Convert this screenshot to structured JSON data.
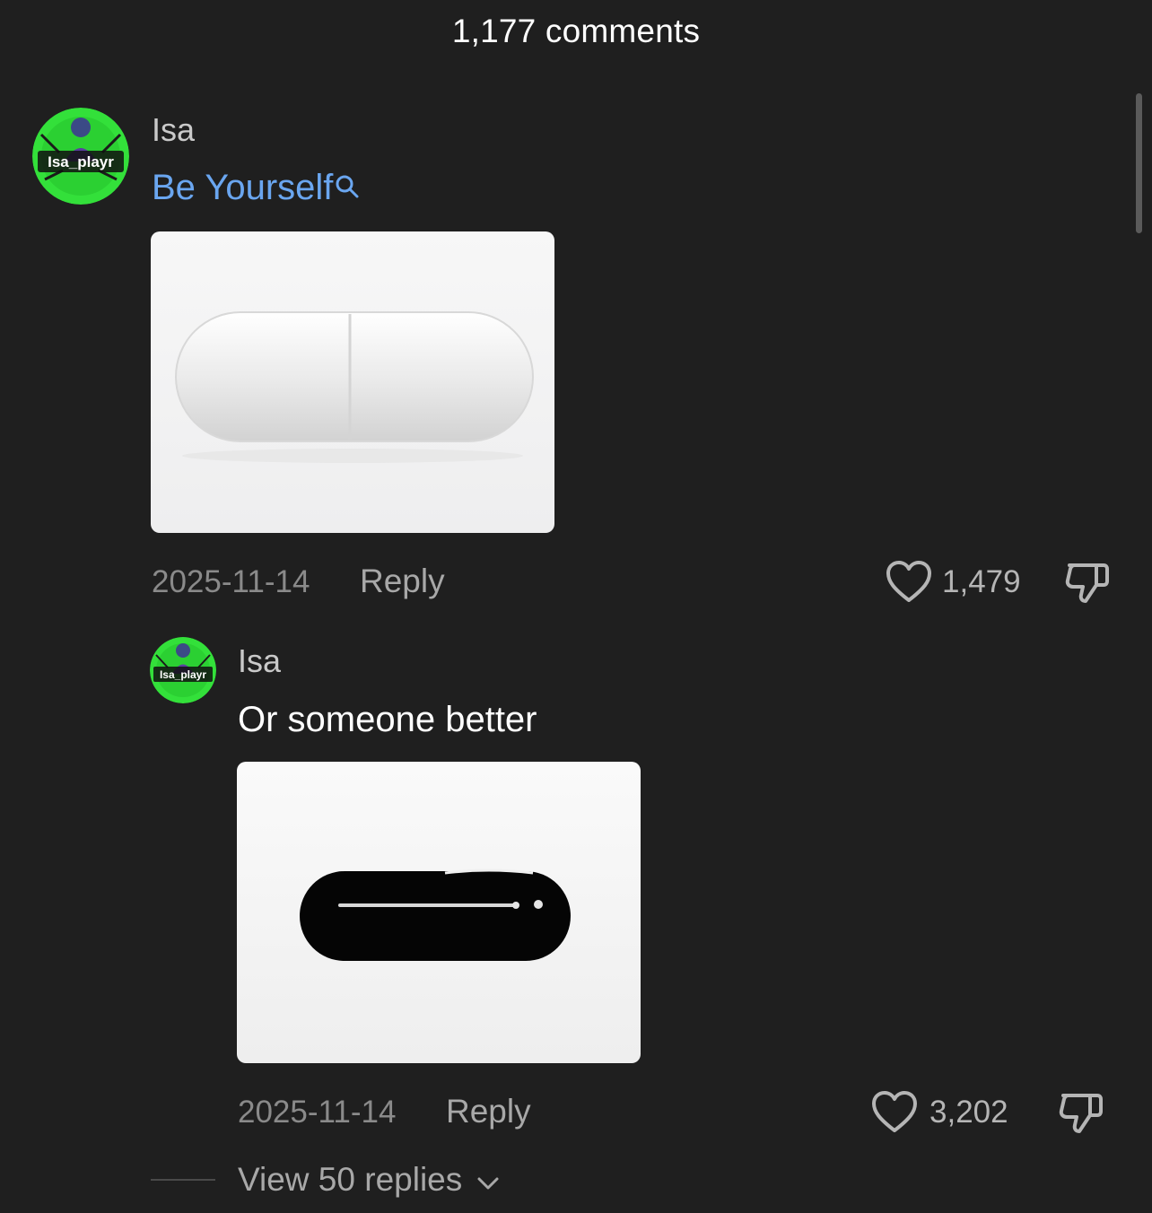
{
  "header": {
    "title": "1,177 comments"
  },
  "colors": {
    "background": "#1f1f1f",
    "link": "#6aa6f0",
    "avatar_ring": "#33e03a"
  },
  "comments": [
    {
      "username": "Isa",
      "avatar_label": "Isa_playr",
      "text": "Be Yourself",
      "text_is_search_link": true,
      "media": "white-capsule-pill",
      "date": "2025-11-14",
      "reply_label": "Reply",
      "likes": "1,479"
    },
    {
      "username": "Isa",
      "avatar_label": "Isa_playr",
      "text": "Or someone better",
      "media": "black-capsule-pill",
      "date": "2025-11-14",
      "reply_label": "Reply",
      "likes": "3,202"
    }
  ],
  "view_replies": {
    "label": "View 50 replies"
  },
  "icons": [
    "search-icon",
    "heart-icon",
    "dislike-icon",
    "chevron-down-icon"
  ]
}
